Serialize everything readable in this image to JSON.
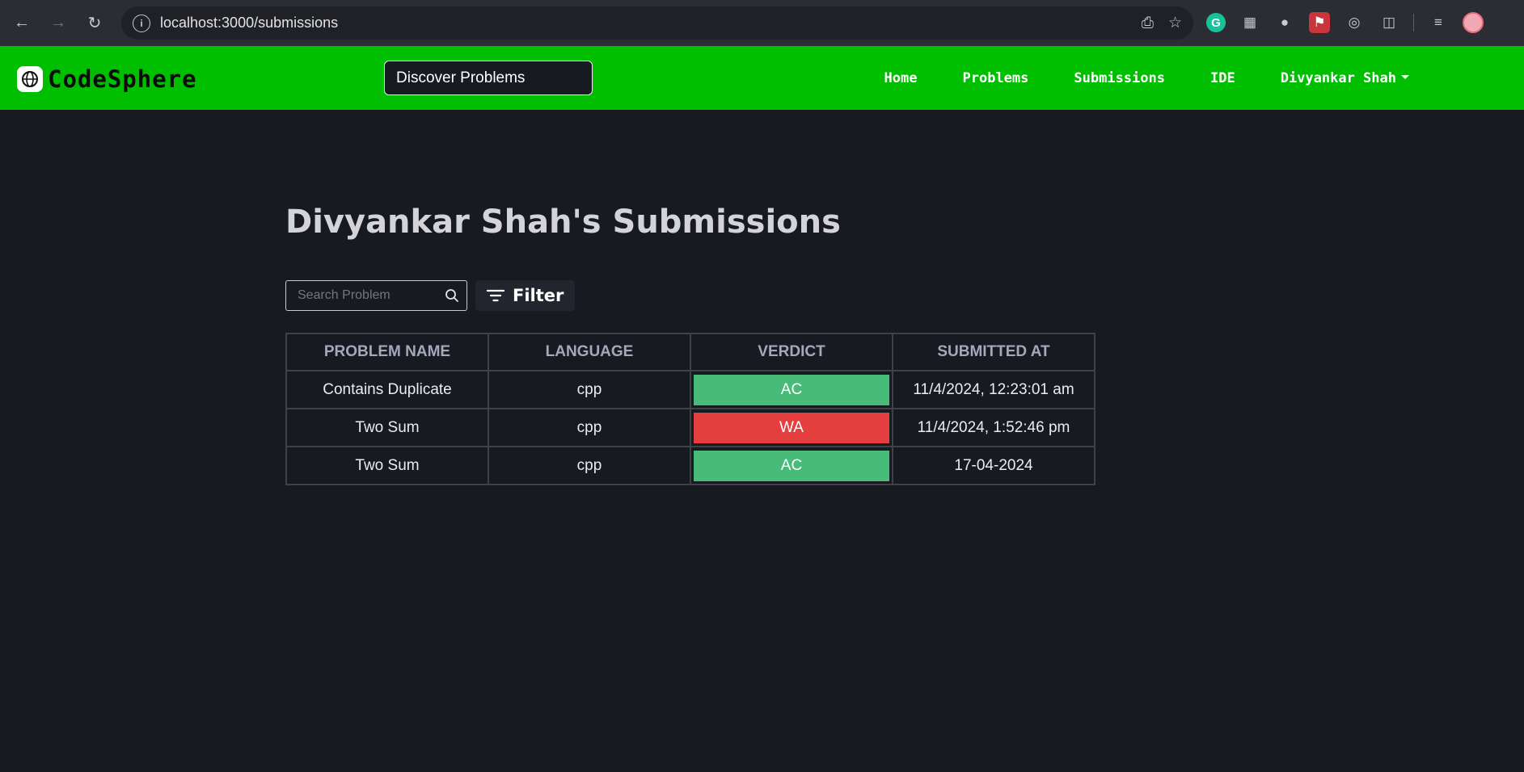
{
  "browser": {
    "url": "localhost:3000/submissions"
  },
  "navbar": {
    "brand": "CodeSphere",
    "discover_label": "Discover Problems",
    "links": [
      {
        "label": "Home"
      },
      {
        "label": "Problems"
      },
      {
        "label": "Submissions"
      },
      {
        "label": "IDE"
      }
    ],
    "user": "Divyankar Shah"
  },
  "page": {
    "title": "Divyankar Shah's Submissions",
    "search_placeholder": "Search Problem",
    "filter_label": "Filter"
  },
  "table": {
    "headers": [
      "Problem Name",
      "Language",
      "Verdict",
      "Submitted At"
    ],
    "rows": [
      {
        "problem": "Contains Duplicate",
        "language": "cpp",
        "verdict": "AC",
        "submitted_at": "11/4/2024, 12:23:01 am"
      },
      {
        "problem": "Two Sum",
        "language": "cpp",
        "verdict": "WA",
        "submitted_at": "11/4/2024, 1:52:46 pm"
      },
      {
        "problem": "Two Sum",
        "language": "cpp",
        "verdict": "AC",
        "submitted_at": "17-04-2024"
      }
    ]
  },
  "colors": {
    "navbar": "#00bf00",
    "background": "#181a22",
    "verdict_ac": "#48bb78",
    "verdict_wa": "#e53e3e"
  }
}
